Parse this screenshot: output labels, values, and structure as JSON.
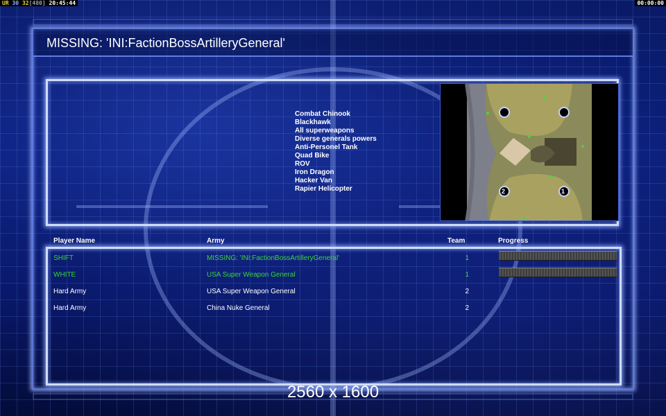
{
  "status_bar": {
    "ur_label": "UR",
    "fps_value": "30",
    "frame_value": "32",
    "frame_max": "480",
    "clock": "20:45:44",
    "timer": "00:00:00"
  },
  "title": "MISSING: 'INI:FactionBossArtilleryGeneral'",
  "units": [
    "Combat Chinook",
    "Blackhawk",
    "All superweapons",
    "Diverse generals powers",
    "Anti-Personel Tank",
    "Quad Bike",
    "ROV",
    "Iron Dragon",
    "Hacker Van",
    "Rapier Helicopter"
  ],
  "map": {
    "start_markers": [
      "2",
      "1"
    ]
  },
  "columns": {
    "player_name": "Player Name",
    "army": "Army",
    "team": "Team",
    "progress": "Progress"
  },
  "players": [
    {
      "name": "SHIFT",
      "army": "MISSING: 'INI:FactionBossArtilleryGeneral'",
      "team": "1",
      "color": "#39d639",
      "progress_visible": true
    },
    {
      "name": "WHITE",
      "army": "USA Super Weapon General",
      "team": "1",
      "color": "#39d639",
      "progress_visible": true
    },
    {
      "name": "Hard Army",
      "army": "USA Super Weapon General",
      "team": "2",
      "color": "#ffffff",
      "progress_visible": false
    },
    {
      "name": "Hard Army",
      "army": "China Nuke General",
      "team": "2",
      "color": "#ffffff",
      "progress_visible": false
    }
  ],
  "resolution_label": "2560 x 1600"
}
